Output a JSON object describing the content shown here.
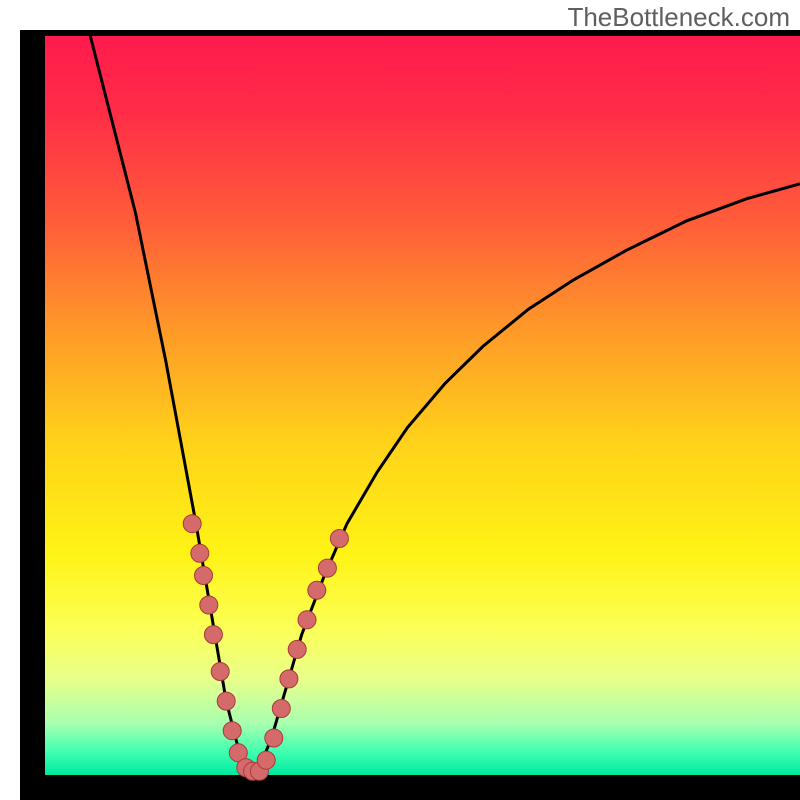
{
  "watermark": "TheBottleneck.com",
  "colors": {
    "frame": "#000000",
    "curve": "#000000",
    "marker_fill": "#d46a6a",
    "marker_stroke": "#a83a3a",
    "gradient_stops": [
      {
        "offset": 0.0,
        "color": "#ff1a4d"
      },
      {
        "offset": 0.1,
        "color": "#ff2c47"
      },
      {
        "offset": 0.25,
        "color": "#ff5c3a"
      },
      {
        "offset": 0.4,
        "color": "#ff9a28"
      },
      {
        "offset": 0.55,
        "color": "#ffd21a"
      },
      {
        "offset": 0.7,
        "color": "#fff315"
      },
      {
        "offset": 0.8,
        "color": "#fcff55"
      },
      {
        "offset": 0.87,
        "color": "#e8ff8a"
      },
      {
        "offset": 0.93,
        "color": "#a8ffaf"
      },
      {
        "offset": 0.97,
        "color": "#3dffb0"
      },
      {
        "offset": 1.0,
        "color": "#00e8a0"
      }
    ]
  },
  "layout": {
    "frame_left": 20,
    "frame_top": 30,
    "frame_right": 800,
    "frame_bottom": 800,
    "inner_left": 45,
    "inner_top": 36,
    "inner_right": 800,
    "inner_bottom": 775
  },
  "chart_data": {
    "type": "line",
    "title": "",
    "xlabel": "",
    "ylabel": "",
    "x_range": [
      0,
      100
    ],
    "y_range": [
      0,
      100
    ],
    "curve": {
      "comment": "V-shaped bottleneck curve; y is mismatch percentage (0 = optimal). Minimum around x≈27.",
      "points": [
        {
          "x": 6,
          "y": 100
        },
        {
          "x": 8,
          "y": 92
        },
        {
          "x": 10,
          "y": 84
        },
        {
          "x": 12,
          "y": 76
        },
        {
          "x": 14,
          "y": 66
        },
        {
          "x": 16,
          "y": 56
        },
        {
          "x": 18,
          "y": 45
        },
        {
          "x": 20,
          "y": 34
        },
        {
          "x": 22,
          "y": 22
        },
        {
          "x": 24,
          "y": 10
        },
        {
          "x": 26,
          "y": 2
        },
        {
          "x": 27,
          "y": 0
        },
        {
          "x": 28,
          "y": 0
        },
        {
          "x": 30,
          "y": 5
        },
        {
          "x": 32,
          "y": 12
        },
        {
          "x": 34,
          "y": 19
        },
        {
          "x": 37,
          "y": 27
        },
        {
          "x": 40,
          "y": 34
        },
        {
          "x": 44,
          "y": 41
        },
        {
          "x": 48,
          "y": 47
        },
        {
          "x": 53,
          "y": 53
        },
        {
          "x": 58,
          "y": 58
        },
        {
          "x": 64,
          "y": 63
        },
        {
          "x": 70,
          "y": 67
        },
        {
          "x": 77,
          "y": 71
        },
        {
          "x": 85,
          "y": 75
        },
        {
          "x": 93,
          "y": 78
        },
        {
          "x": 100,
          "y": 80
        }
      ]
    },
    "markers": {
      "comment": "Pink dot markers clustered along the lower portion of the V near the bottom.",
      "radius": 9,
      "points": [
        {
          "x": 19.5,
          "y": 34
        },
        {
          "x": 20.5,
          "y": 30
        },
        {
          "x": 21.0,
          "y": 27
        },
        {
          "x": 21.7,
          "y": 23
        },
        {
          "x": 22.3,
          "y": 19
        },
        {
          "x": 23.2,
          "y": 14
        },
        {
          "x": 24.0,
          "y": 10
        },
        {
          "x": 24.8,
          "y": 6
        },
        {
          "x": 25.6,
          "y": 3
        },
        {
          "x": 26.6,
          "y": 1
        },
        {
          "x": 27.5,
          "y": 0.5
        },
        {
          "x": 28.4,
          "y": 0.5
        },
        {
          "x": 29.3,
          "y": 2
        },
        {
          "x": 30.3,
          "y": 5
        },
        {
          "x": 31.3,
          "y": 9
        },
        {
          "x": 32.3,
          "y": 13
        },
        {
          "x": 33.4,
          "y": 17
        },
        {
          "x": 34.7,
          "y": 21
        },
        {
          "x": 36.0,
          "y": 25
        },
        {
          "x": 37.4,
          "y": 28
        },
        {
          "x": 39.0,
          "y": 32
        }
      ]
    }
  }
}
